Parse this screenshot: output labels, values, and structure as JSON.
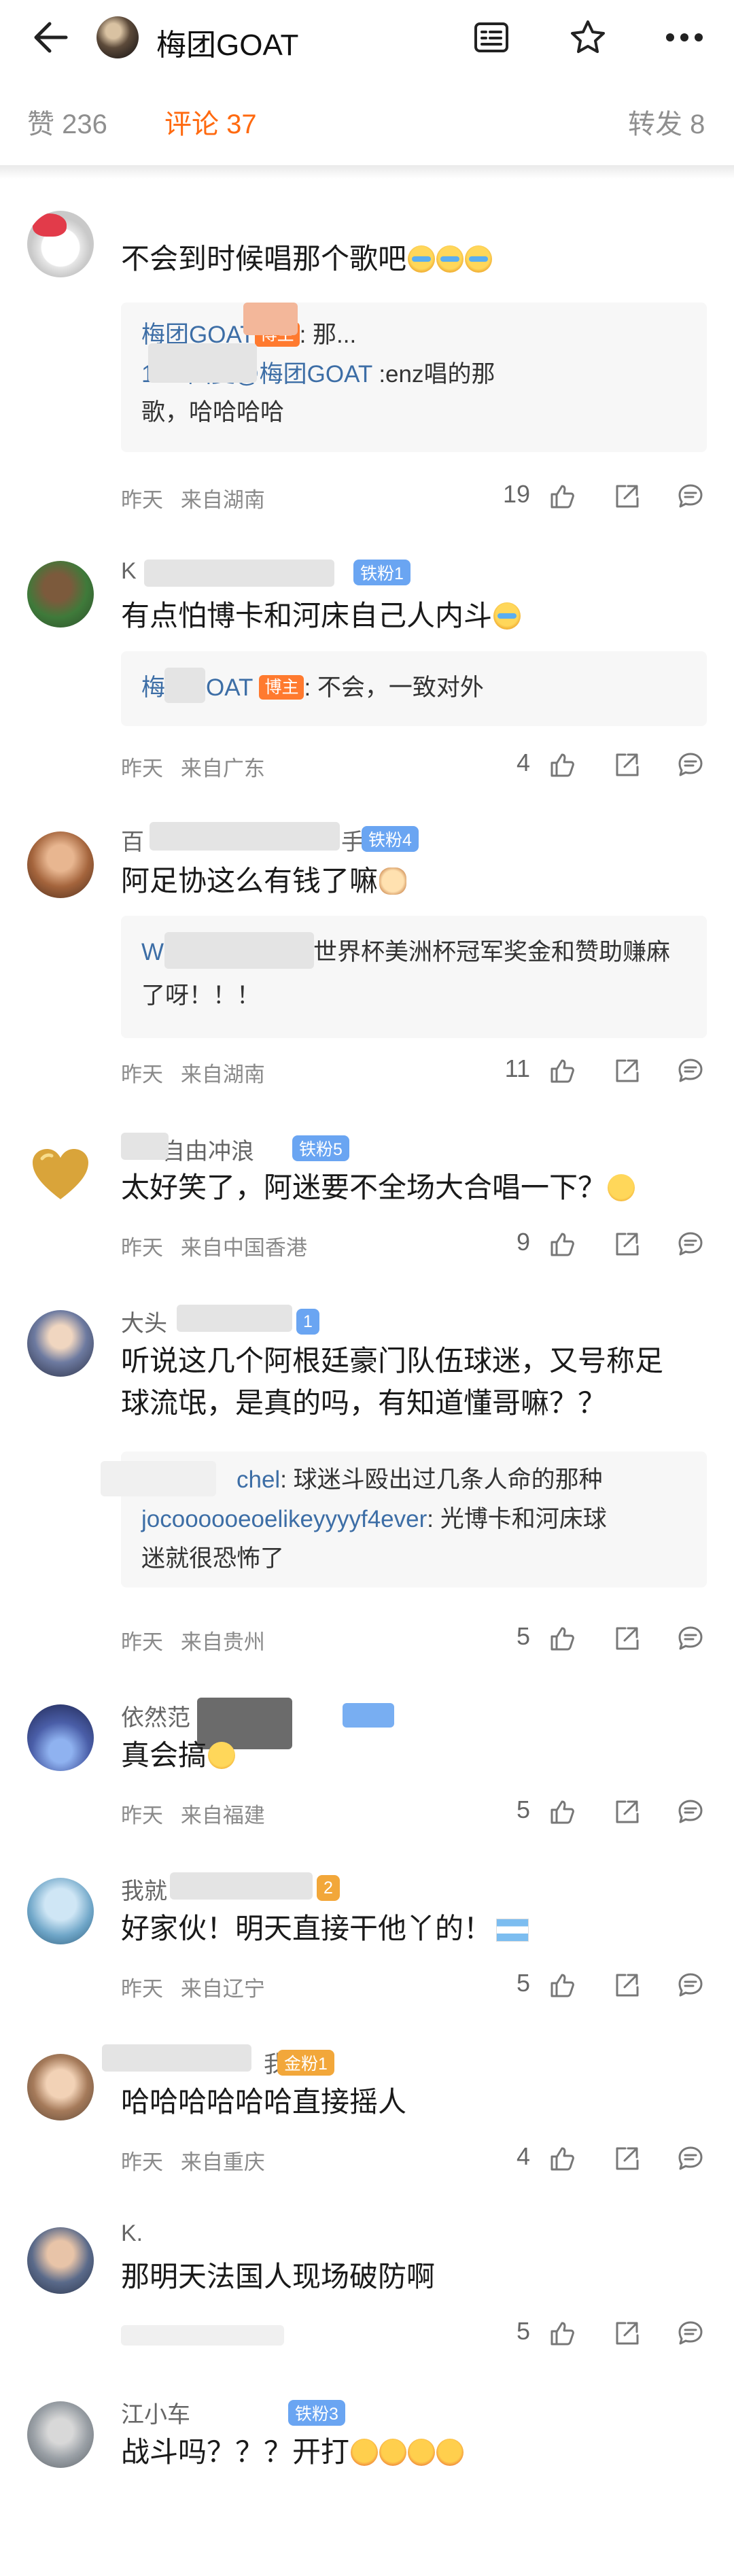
{
  "header": {
    "title": "梅团GOAT",
    "icons": [
      "back-arrow-icon",
      "avatar",
      "list-icon",
      "star-icon",
      "more-icon"
    ]
  },
  "tabs": {
    "likes": "赞 236",
    "comments": "评论 37",
    "reposts": "转发 8"
  },
  "comments": [
    {
      "user": "",
      "text": "不会到时候唱那个歌吧",
      "reply_lines": [
        {
          "user": "梅团GOAT",
          "badge": "博主",
          "text": ": 那..."
        },
        {
          "user": "",
          "text": "123 回复"
        },
        {
          "mention": "@梅团GOAT",
          "text": " :enz唱的那"
        },
        {
          "text": "歌，哈哈哈哈"
        }
      ],
      "time": "昨天",
      "location": "来自湖南",
      "likes": "19"
    },
    {
      "user": "K",
      "badge": "铁粉1",
      "text": "有点怕博卡和河床自己人内斗",
      "reply": {
        "user": "梅",
        "user_end": "OAT",
        "badge": "博主",
        "text": ": 不会，一致对外"
      },
      "time": "昨天",
      "location": "来自广东",
      "likes": "4"
    },
    {
      "user": "百",
      "user_end": "手",
      "badge": "铁粉4",
      "text": "阿足协这么有钱了嘛",
      "reply_lines": [
        {
          "user": "W",
          "text": "世界杯美洲杯冠军奖金和赞助赚麻"
        },
        {
          "text": "了呀！！！"
        }
      ],
      "time": "昨天",
      "location": "来自湖南",
      "likes": "11"
    },
    {
      "user": "",
      "user_end": "自由冲浪",
      "badge": "铁粉5",
      "text": "太好笑了，阿迷要不全场大合唱一下？",
      "time": "昨天",
      "location": "来自中国香港",
      "likes": "9"
    },
    {
      "user": "大头",
      "badge": "1",
      "text_lines": [
        "听说这几个阿根廷豪门队伍球迷，又号称足",
        "球流氓，是真的吗，有知道懂哥嘛？？"
      ],
      "reply_lines": [
        {
          "user": "chel",
          "text": ": 球迷斗殴出过几条人命的那种"
        },
        {
          "user": "jocoooooeoelikeyyyyf4ever",
          "text": ": 光博卡和河床球"
        },
        {
          "text": "迷就很恐怖了"
        }
      ],
      "time": "昨天",
      "location": "来自贵州",
      "likes": "5"
    },
    {
      "user": "依然范",
      "text": "真会搞",
      "time": "昨天",
      "location": "来自福建",
      "likes": "5"
    },
    {
      "user": "我就",
      "badge": "2",
      "text": "好家伙！明天直接干他丫的！",
      "time": "昨天",
      "location": "来自辽宁",
      "likes": "5"
    },
    {
      "user": "",
      "user_end": "我",
      "badge": "金粉1",
      "text": "哈哈哈哈哈哈直接摇人",
      "time": "昨天",
      "location": "来自重庆",
      "likes": "4"
    },
    {
      "user": "K.",
      "text": "那明天法国人现场破防啊",
      "time": "",
      "location": "",
      "likes": "5"
    },
    {
      "user": "江小车",
      "badge": "铁粉3",
      "text": "战斗吗？？？开打",
      "time": "",
      "location": "",
      "likes": ""
    }
  ],
  "colors": {
    "accent": "#ff6a10",
    "badge_blue": "#6aa5f2",
    "host_badge": "#ff7a2f",
    "link": "#3d6ea6"
  }
}
